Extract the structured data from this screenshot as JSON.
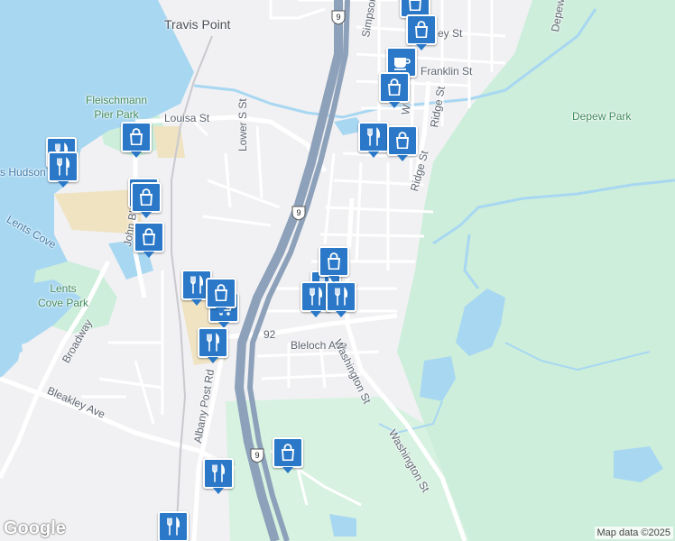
{
  "labels": {
    "travis_point": "Travis Point",
    "fleischmann_pier_park": "Fleischmann\nPier Park",
    "louisa_st": "Louisa St",
    "lower_s_st": "Lower S St",
    "simpson": "Simpson",
    "franklin_st": "Franklin St",
    "ey_st": "ey St",
    "ridge_st_upper": "Ridge St",
    "ridge_st_lower": "Ridge St",
    "w_st": "W",
    "depew_park": "Depew Park",
    "depew_top": "Depew",
    "s_hudson": "s Hudson",
    "lents_cove": "Lents Cove",
    "john_blvd": "John Blvd",
    "lents_cove_park": "Lents\nCove Park",
    "broadway": "Broadway",
    "bleakley_ave": "Bleakley Ave",
    "albany_post_rd": "Albany Post Rd",
    "bleloch_ave": "Bleloch Ave",
    "route_92": "92",
    "washington_st_1": "Washington St",
    "washington_st_2": "Washington St"
  },
  "shields": {
    "route_9_top": "9",
    "route_9_mid": "9",
    "route_9_bottom": "9"
  },
  "markers": [
    {
      "type": "shopping",
      "icon": "shopping-bag-icon"
    },
    {
      "type": "shopping",
      "icon": "shopping-bag-icon"
    },
    {
      "type": "cafe",
      "icon": "coffee-cup-icon"
    },
    {
      "type": "shopping",
      "icon": "shopping-bag-icon"
    },
    {
      "type": "restaurant",
      "icon": "fork-knife-icon"
    },
    {
      "type": "shopping",
      "icon": "shopping-bag-icon"
    },
    {
      "type": "restaurant",
      "icon": "fork-knife-icon"
    },
    {
      "type": "shopping",
      "icon": "shopping-bag-icon"
    },
    {
      "type": "shopping",
      "icon": "shopping-bag-icon"
    },
    {
      "type": "shopping",
      "icon": "shopping-bag-icon"
    },
    {
      "type": "shopping",
      "icon": "shopping-bag-icon"
    },
    {
      "type": "restaurant",
      "icon": "fork-knife-icon"
    },
    {
      "type": "restaurant",
      "icon": "fork-knife-icon"
    },
    {
      "type": "restaurant",
      "icon": "fork-knife-icon"
    },
    {
      "type": "restaurant",
      "icon": "fork-knife-icon"
    },
    {
      "type": "shopping",
      "icon": "shopping-bag-icon"
    },
    {
      "type": "grocery",
      "icon": "shopping-cart-icon"
    },
    {
      "type": "restaurant",
      "icon": "fork-knife-icon"
    },
    {
      "type": "shopping",
      "icon": "shopping-bag-icon"
    },
    {
      "type": "restaurant",
      "icon": "fork-knife-icon"
    },
    {
      "type": "restaurant",
      "icon": "fork-knife-icon"
    },
    {
      "type": "restaurant",
      "icon": "fork-knife-icon"
    }
  ],
  "colors": {
    "water": "#a8d7f2",
    "park": "#cdeedb",
    "land": "#f1f1f3",
    "highway": "#8da2ba",
    "marker": "#2a78c7"
  },
  "attribution": {
    "logo": "Google",
    "credit": "Map data ©2025"
  }
}
